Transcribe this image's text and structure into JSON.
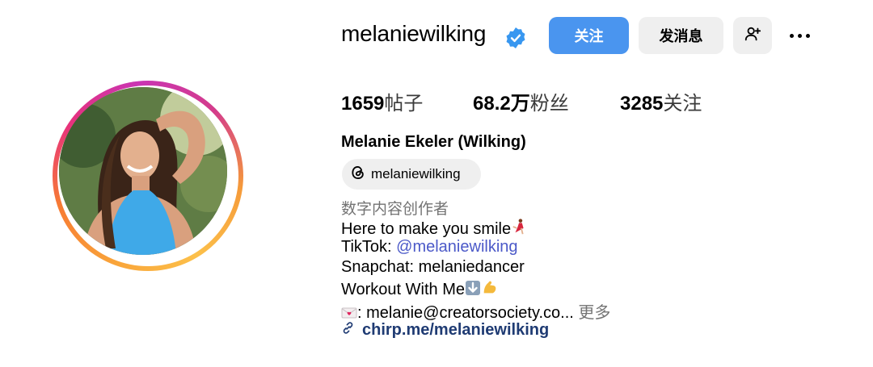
{
  "profile": {
    "username": "melaniewilking",
    "full_name": "Melanie Ekeler (Wilking)",
    "threads_handle": "melaniewilking",
    "category": "数字内容创作者"
  },
  "actions": {
    "follow_label": "关注",
    "message_label": "发消息"
  },
  "stats": {
    "posts_count": "1659",
    "posts_label": "帖子",
    "followers_count": "68.2万",
    "followers_label": "粉丝",
    "following_count": "3285",
    "following_label": "关注"
  },
  "bio": {
    "line1": "Here to make you smile",
    "line2_prefix": "TikTok: ",
    "line2_link": "@melaniewilking",
    "line3": "Snapchat: melaniedancer",
    "line4": "Workout With Me",
    "line5_text": ": melanie@creatorsociety.co...",
    "more_label": "更多",
    "website": "chirp.me/melaniewilking"
  },
  "icons": {
    "verified": "verified-badge-icon",
    "add_user": "add-person-icon",
    "more": "more-horizontal-icon",
    "threads": "threads-logo-icon",
    "link": "link-icon",
    "dancer": "dancer-emoji-icon",
    "down_arrow": "down-arrow-emoji-icon",
    "flexed_biceps": "flexed-biceps-emoji-icon",
    "love_letter": "love-letter-emoji-icon"
  },
  "colors": {
    "follow_button": "#4a95ef",
    "secondary_button": "#efefef",
    "verified_badge": "#3897f0",
    "link_text": "#4b59c8",
    "website_text": "#1f3b73",
    "muted_text": "#737373"
  }
}
